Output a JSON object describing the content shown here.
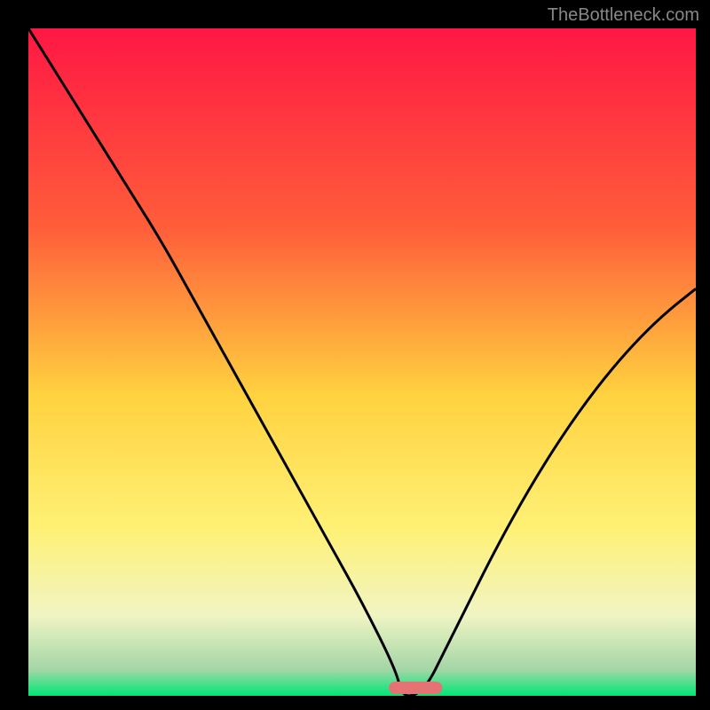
{
  "watermark": "TheBottleneck.com",
  "chart_data": {
    "type": "line",
    "title": "",
    "xlabel": "",
    "ylabel": "",
    "xlim": [
      0,
      100
    ],
    "ylim": [
      0,
      100
    ],
    "x": [
      0,
      5,
      10,
      15,
      20,
      25,
      30,
      35,
      40,
      45,
      50,
      55,
      56,
      58,
      60,
      62,
      65,
      70,
      75,
      80,
      85,
      90,
      95,
      100
    ],
    "values": [
      100,
      92,
      84,
      76,
      68,
      59,
      50,
      41,
      32,
      23,
      14,
      4,
      0,
      0,
      2,
      6,
      12,
      22,
      31,
      39,
      46,
      52,
      57,
      61
    ],
    "optimum_range_x": [
      54,
      62
    ],
    "gradient_stops": [
      {
        "offset": 0.0,
        "color": "#ff1744"
      },
      {
        "offset": 0.3,
        "color": "#ff5e3a"
      },
      {
        "offset": 0.55,
        "color": "#ffd23f"
      },
      {
        "offset": 0.75,
        "color": "#fff176"
      },
      {
        "offset": 0.88,
        "color": "#f0f4c3"
      },
      {
        "offset": 0.96,
        "color": "#a5d6a7"
      },
      {
        "offset": 1.0,
        "color": "#00e676"
      }
    ],
    "marker": {
      "color": "#e57373",
      "shape": "pill"
    }
  }
}
